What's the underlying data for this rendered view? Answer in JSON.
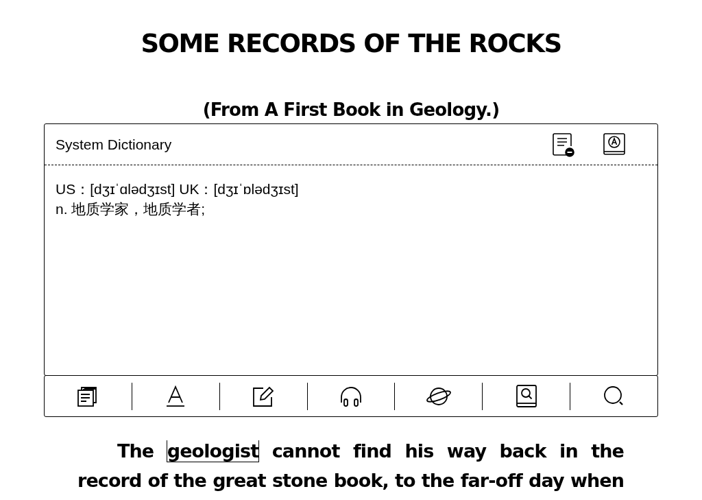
{
  "book": {
    "title": "SOME RECORDS OF THE ROCKS",
    "subtitle": "(From A First Book in Geology.)",
    "lines": [
      {
        "before": "The ",
        "selected_word": "geologist",
        "after": " cannot find his way back in the"
      },
      {
        "before": "record of the great stone book, to the far-off day when"
      }
    ]
  },
  "dictionary": {
    "title": "System Dictionary",
    "header_tools": [
      {
        "kind": "doc-minus"
      },
      {
        "kind": "dict-a"
      }
    ],
    "pronunciation": "US：[dʒɪˈɑlədʒɪst] UK：[dʒɪˈɒlədʒɪst]",
    "definition": "n. 地质学家，地质学者;",
    "toolbar": [
      {
        "kind": "copy"
      },
      {
        "kind": "font"
      },
      {
        "kind": "edit"
      },
      {
        "kind": "audio"
      },
      {
        "kind": "planet"
      },
      {
        "kind": "book-search"
      },
      {
        "kind": "search"
      }
    ]
  }
}
